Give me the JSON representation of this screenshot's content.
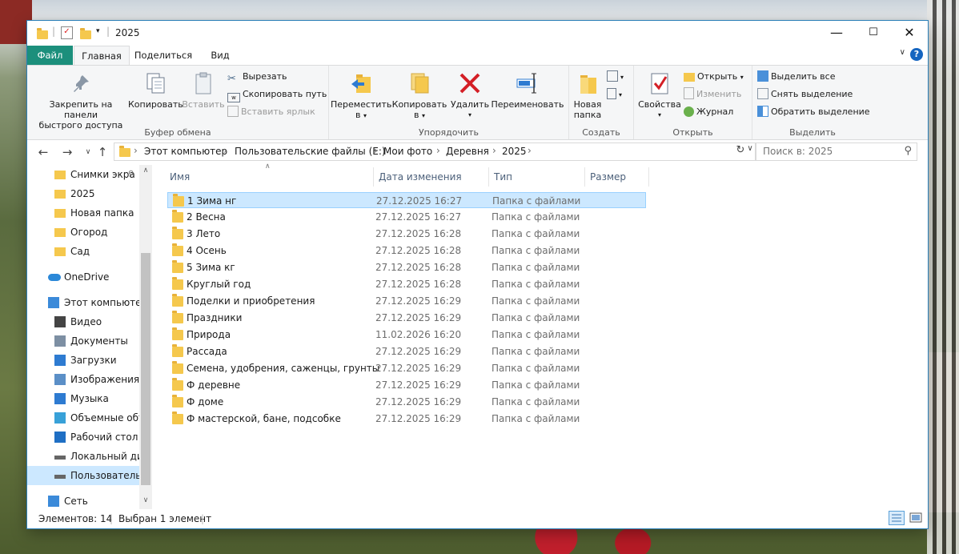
{
  "window": {
    "title": "2025"
  },
  "menu": {
    "file": "Файл",
    "home": "Главная",
    "share": "Поделиться",
    "view": "Вид"
  },
  "ribbon": {
    "clipboard": {
      "label": "Буфер обмена",
      "pin_line1": "Закрепить на панели",
      "pin_line2": "быстрого доступа",
      "copy": "Копировать",
      "paste": "Вставить",
      "cut": "Вырезать",
      "copy_path": "Скопировать путь",
      "paste_shortcut": "Вставить ярлык"
    },
    "organize": {
      "label": "Упорядочить",
      "move_line1": "Переместить",
      "move_line2": "в",
      "copy_line1": "Копировать",
      "copy_line2": "в",
      "delete": "Удалить",
      "rename": "Переименовать"
    },
    "create": {
      "label": "Создать",
      "new_line1": "Новая",
      "new_line2": "папка"
    },
    "open": {
      "label": "Открыть",
      "properties": "Свойства",
      "open": "Открыть",
      "edit": "Изменить",
      "history": "Журнал"
    },
    "select": {
      "label": "Выделить",
      "select_all": "Выделить все",
      "select_none": "Снять выделение",
      "invert": "Обратить выделение"
    }
  },
  "address": {
    "crumbs": [
      "Этот компьютер",
      "Пользовательские файлы (E:)",
      "Мои фото",
      "Деревня",
      "2025"
    ]
  },
  "search": {
    "placeholder": "Поиск в: 2025"
  },
  "nav": {
    "items": [
      {
        "label": "Снимки экра",
        "icon": "folder-icon"
      },
      {
        "label": "2025",
        "icon": "folder-icon"
      },
      {
        "label": "Новая папка",
        "icon": "folder-icon"
      },
      {
        "label": "Огород",
        "icon": "folder-icon"
      },
      {
        "label": "Сад",
        "icon": "folder-icon"
      },
      {
        "label": "OneDrive",
        "icon": "cloud-icon"
      },
      {
        "label": "Этот компьютер",
        "icon": "computer-icon"
      },
      {
        "label": "Видео",
        "icon": "video-icon"
      },
      {
        "label": "Документы",
        "icon": "document-icon"
      },
      {
        "label": "Загрузки",
        "icon": "download-icon"
      },
      {
        "label": "Изображения",
        "icon": "image-icon"
      },
      {
        "label": "Музыка",
        "icon": "music-icon"
      },
      {
        "label": "Объемные объ",
        "icon": "3d-objects-icon"
      },
      {
        "label": "Рабочий стол",
        "icon": "desktop-icon"
      },
      {
        "label": "Локальный дис",
        "icon": "drive-icon"
      },
      {
        "label": "Пользовательс",
        "icon": "drive-icon"
      },
      {
        "label": "Сеть",
        "icon": "network-icon"
      }
    ]
  },
  "columns": {
    "name": "Имя",
    "date": "Дата изменения",
    "type": "Тип",
    "size": "Размер"
  },
  "files": [
    {
      "name": "1 Зима нг",
      "date": "27.12.2025 16:27",
      "type": "Папка с файлами"
    },
    {
      "name": "2 Весна",
      "date": "27.12.2025 16:27",
      "type": "Папка с файлами"
    },
    {
      "name": "3 Лето",
      "date": "27.12.2025 16:28",
      "type": "Папка с файлами"
    },
    {
      "name": "4 Осень",
      "date": "27.12.2025 16:28",
      "type": "Папка с файлами"
    },
    {
      "name": "5 Зима кг",
      "date": "27.12.2025 16:28",
      "type": "Папка с файлами"
    },
    {
      "name": "Круглый год",
      "date": "27.12.2025 16:28",
      "type": "Папка с файлами"
    },
    {
      "name": "Поделки и приобретения",
      "date": "27.12.2025 16:29",
      "type": "Папка с файлами"
    },
    {
      "name": "Праздники",
      "date": "27.12.2025 16:29",
      "type": "Папка с файлами"
    },
    {
      "name": "Природа",
      "date": "11.02.2026 16:20",
      "type": "Папка с файлами"
    },
    {
      "name": "Рассада",
      "date": "27.12.2025 16:29",
      "type": "Папка с файлами"
    },
    {
      "name": "Семена, удобрения, саженцы, грунты",
      "date": "27.12.2025 16:29",
      "type": "Папка с файлами"
    },
    {
      "name": "Ф деревне",
      "date": "27.12.2025 16:29",
      "type": "Папка с файлами"
    },
    {
      "name": "Ф доме",
      "date": "27.12.2025 16:29",
      "type": "Папка с файлами"
    },
    {
      "name": "Ф мастерской, бане, подсобке",
      "date": "27.12.2025 16:29",
      "type": "Папка с файлами"
    }
  ],
  "status": {
    "count": "Элементов: 14",
    "selected": "Выбран 1 элемент"
  },
  "colors": {
    "accent": "#1c8f7c",
    "selection": "#cce8ff",
    "folder": "#f5c84d"
  }
}
